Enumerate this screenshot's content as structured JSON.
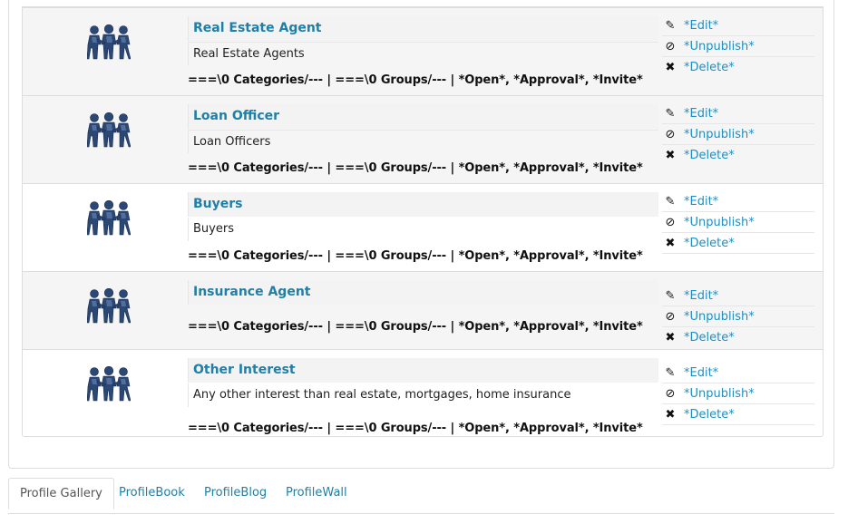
{
  "groups": [
    {
      "title": "Real Estate Agent",
      "description": "Real Estate Agents",
      "meta": "===\\0 Categories/--- | ===\\0 Groups/--- | *Open*, *Approval*, *Invite*",
      "actions": {
        "edit": "*Edit*",
        "unpublish": "*Unpublish*",
        "delete": "*Delete*"
      }
    },
    {
      "title": "Loan Officer",
      "description": "Loan Officers",
      "meta": "===\\0 Categories/--- | ===\\0 Groups/--- | *Open*, *Approval*, *Invite*",
      "actions": {
        "edit": "*Edit*",
        "unpublish": "*Unpublish*",
        "delete": "*Delete*"
      }
    },
    {
      "title": "Buyers",
      "description": "Buyers",
      "meta": "===\\0 Categories/--- | ===\\0 Groups/--- | *Open*, *Approval*, *Invite*",
      "actions": {
        "edit": "*Edit*",
        "unpublish": "*Unpublish*",
        "delete": "*Delete*"
      }
    },
    {
      "title": "Insurance Agent",
      "description": "",
      "meta": "===\\0 Categories/--- | ===\\0 Groups/--- | *Open*, *Approval*, *Invite*",
      "actions": {
        "edit": "*Edit*",
        "unpublish": "*Unpublish*",
        "delete": "*Delete*"
      }
    },
    {
      "title": "Other Interest",
      "description": "Any other interest than real estate, mortgages, home insurance",
      "meta": "===\\0 Categories/--- | ===\\0 Groups/--- | *Open*, *Approval*, *Invite*",
      "actions": {
        "edit": "*Edit*",
        "unpublish": "*Unpublish*",
        "delete": "*Delete*"
      }
    }
  ],
  "icons": {
    "group": "group-people-icon",
    "edit": "pencil-icon",
    "unpublish": "ban-icon",
    "delete": "x-icon"
  },
  "tabs": [
    {
      "label": "Profile Gallery",
      "active": true
    },
    {
      "label": "ProfileBook",
      "active": false
    },
    {
      "label": "ProfileBlog",
      "active": false
    },
    {
      "label": "ProfileWall",
      "active": false
    }
  ],
  "colors": {
    "link": "#1f8fc2",
    "title": "#1f7fa8",
    "group_icon": "#2a4a7a"
  }
}
